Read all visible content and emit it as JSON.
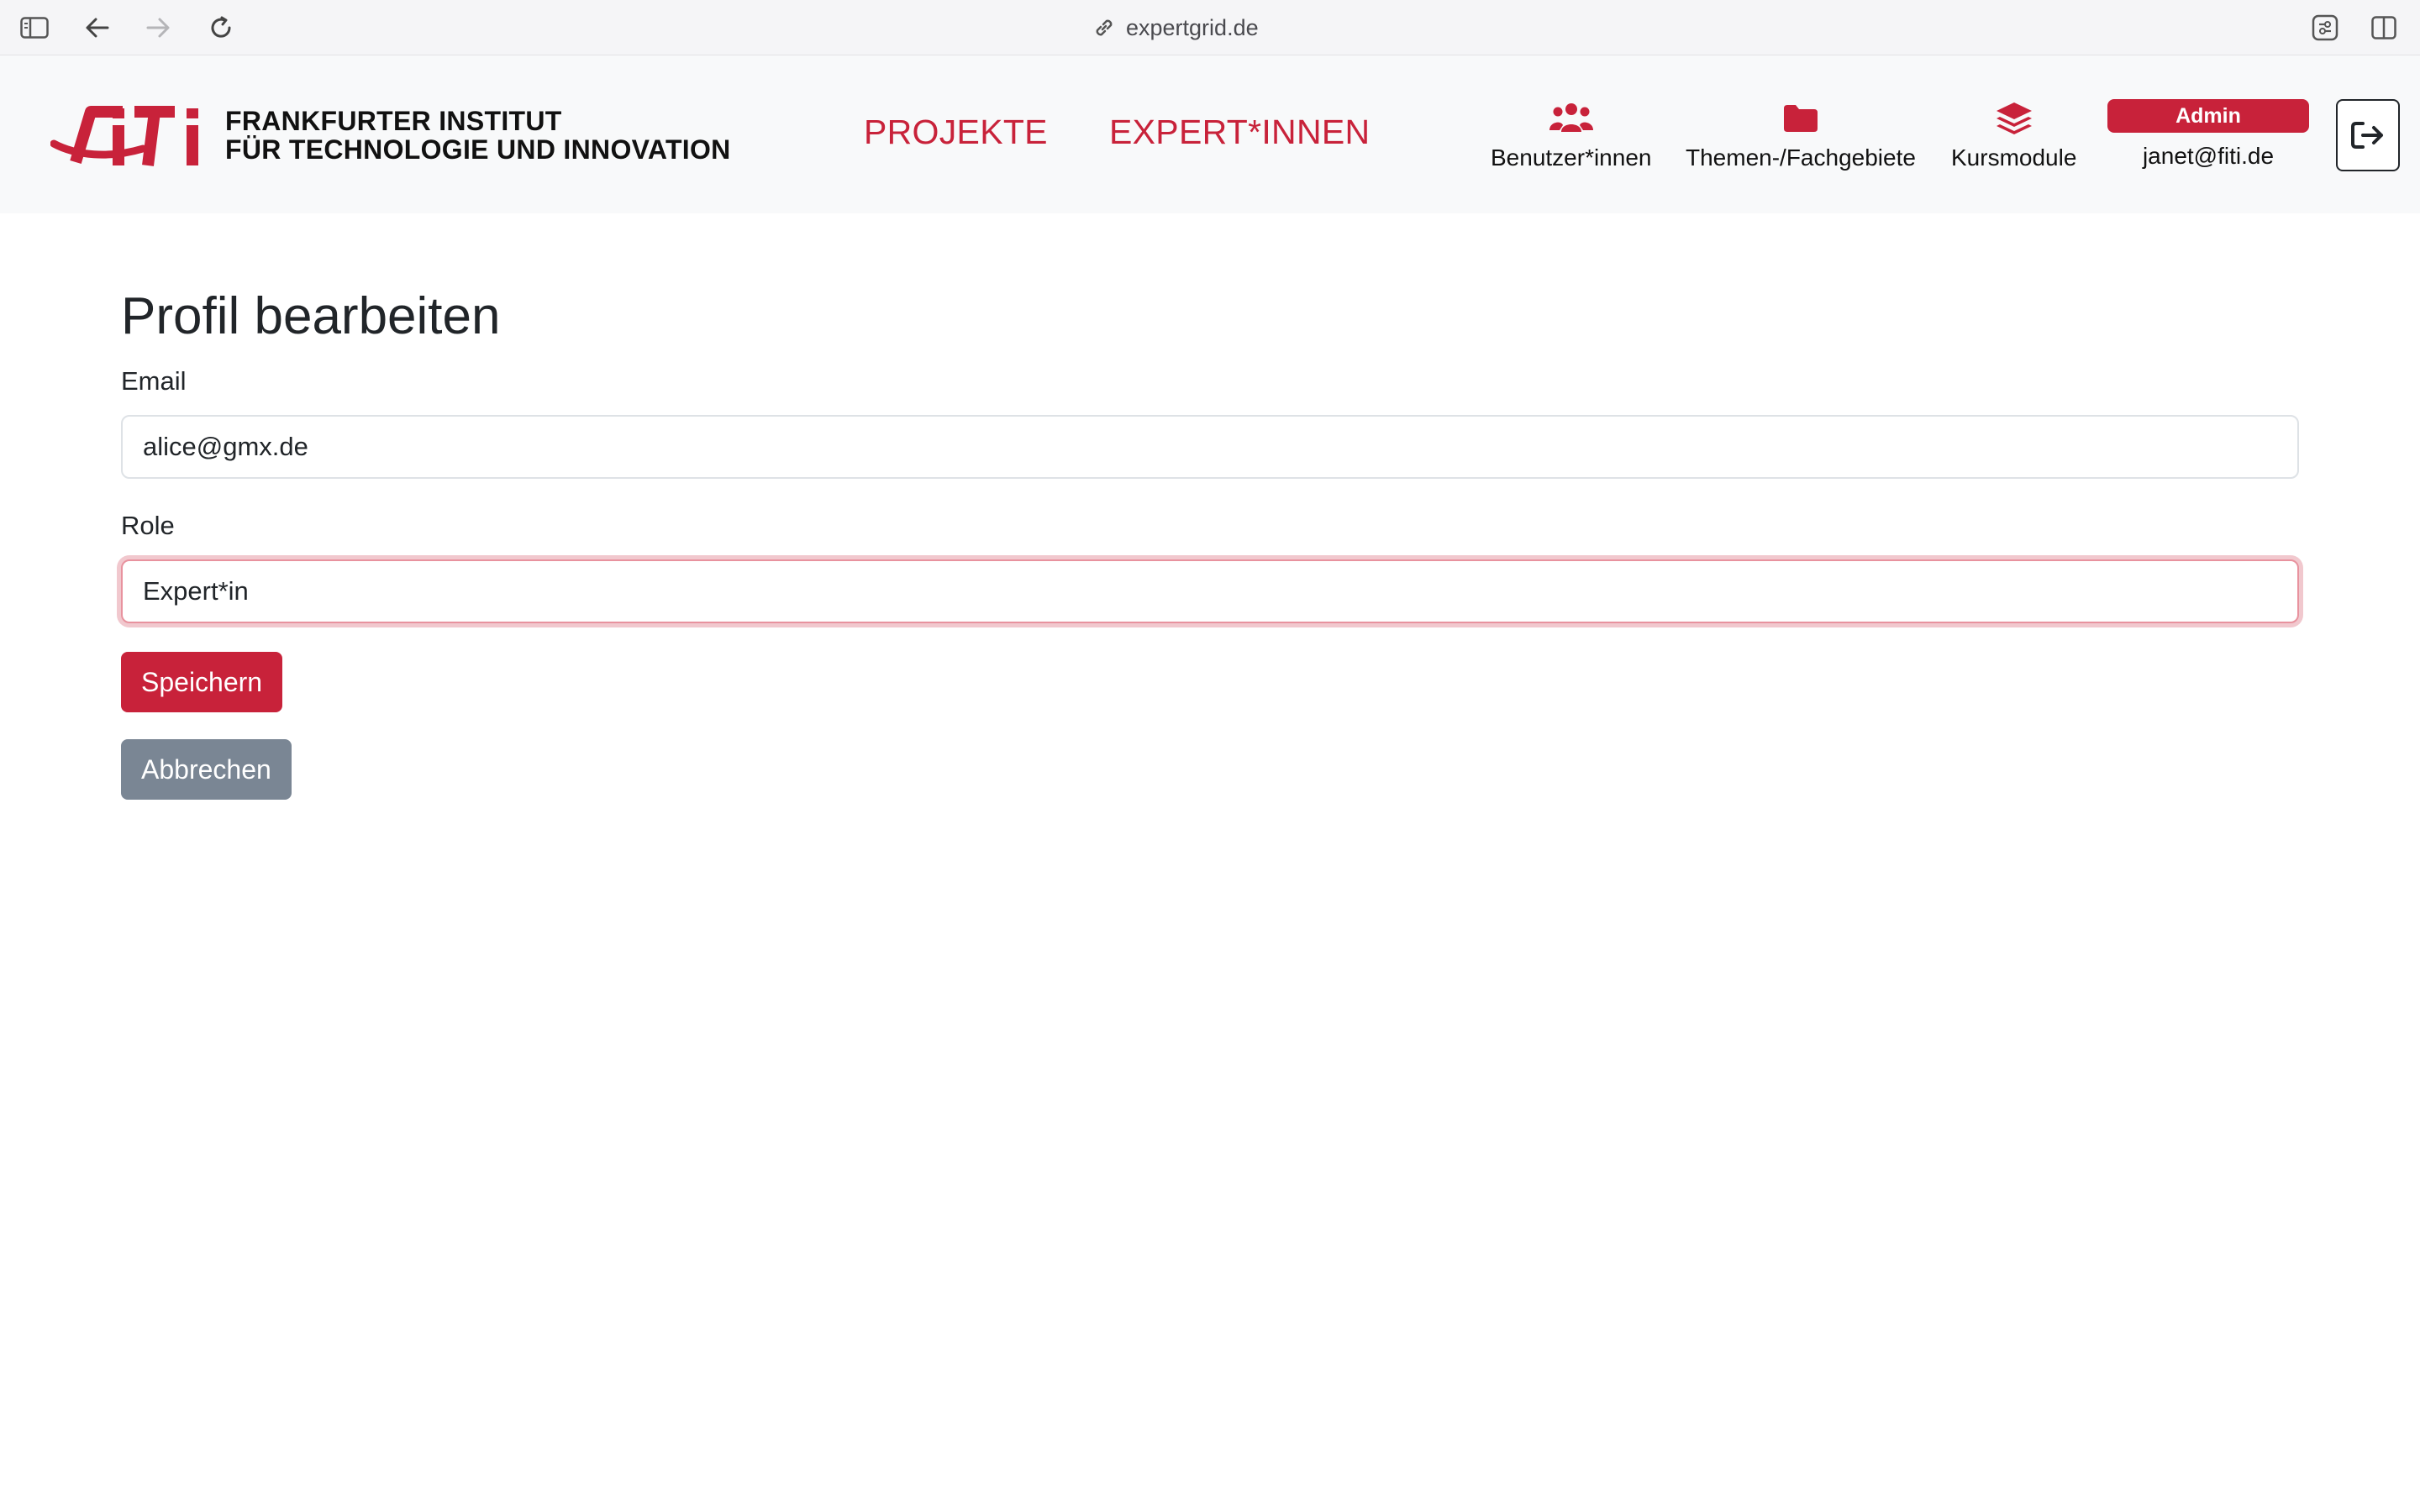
{
  "browser": {
    "url": "expertgrid.de"
  },
  "navbar": {
    "logo_mark": "FITI",
    "logo_line1": "FRANKFURTER INSTITUT",
    "logo_line2": "FÜR TECHNOLOGIE UND INNOVATION",
    "links": [
      "PROJEKTE",
      "EXPERT*INNEN"
    ],
    "tools": [
      {
        "label": "Benutzer*innen",
        "icon": "users-icon"
      },
      {
        "label": "Themen-/Fachgebiete",
        "icon": "folder-icon"
      },
      {
        "label": "Kursmodule",
        "icon": "layers-icon"
      }
    ],
    "role_badge": "Admin",
    "user_email": "janet@fiti.de",
    "logout_icon": "logout-icon"
  },
  "form": {
    "title": "Profil bearbeiten",
    "email_label": "Email",
    "email_value": "alice@gmx.de",
    "role_label": "Role",
    "role_value": "Expert*in",
    "save_label": "Speichern",
    "cancel_label": "Abbrechen"
  },
  "colors": {
    "brand": "#c8223a",
    "secondary": "#7a8694",
    "navbar_bg": "#f8f9fa"
  }
}
